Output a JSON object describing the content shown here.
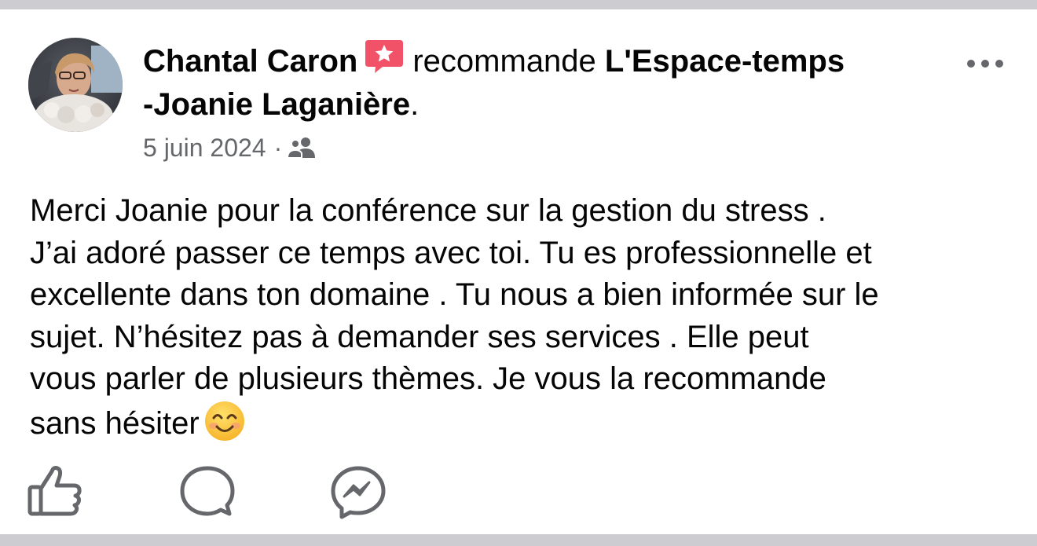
{
  "post": {
    "author": "Chantal Caron",
    "verb": "recommande",
    "page_name_line1": "L'Espace-temps",
    "page_name_line2": "-Joanie Laganière",
    "period": ".",
    "date": "5 juin 2024",
    "separator": "·",
    "audience_icon": "friends-icon",
    "badge_icon": "recommendation-star-icon",
    "body_lines": [
      "Merci Joanie pour la conférence sur la gestion du stress .",
      "J’ai  adoré passer ce temps avec toi. Tu es professionnelle et",
      "excellente dans ton domaine . Tu nous a bien informée sur le",
      "sujet. N’hésitez pas à demander ses services . Elle peut",
      "vous parler de plusieurs thèmes. Je vous la recommande",
      "sans hésiter"
    ],
    "emoji": "smiling-face-emoji"
  },
  "actions": {
    "like_icon": "thumbs-up-icon",
    "comment_icon": "comment-bubble-icon",
    "share_icon": "messenger-icon"
  },
  "colors": {
    "badge": "#f25268",
    "meta_text": "#65676b",
    "icon_gray": "#65676b",
    "page_border": "#cdcdd1"
  }
}
